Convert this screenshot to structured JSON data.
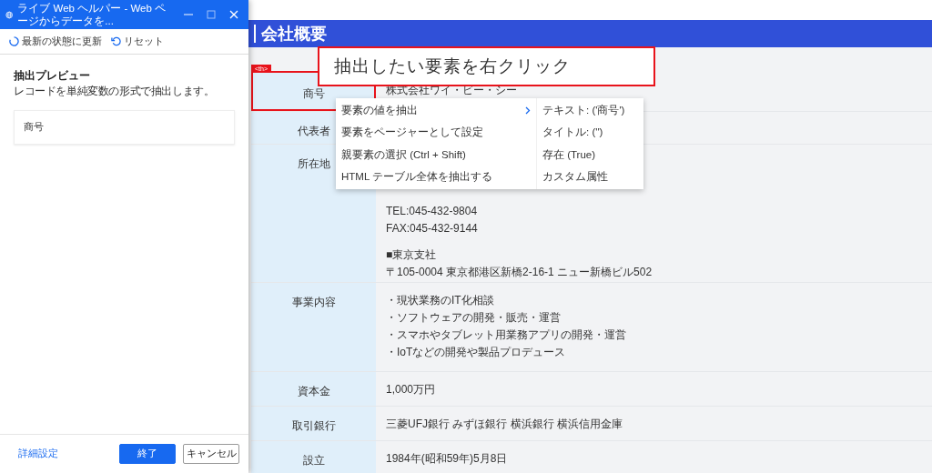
{
  "helper_window": {
    "title": "ライブ Web ヘルパー - Web ページからデータを...",
    "toolbar": [
      {
        "label": "最新の状態に更新",
        "kind": "refresh"
      },
      {
        "label": "リセット",
        "kind": "reset"
      }
    ],
    "preview": {
      "heading": "抽出プレビュー",
      "description": "レコードを単純変数の形式で抽出します。",
      "columns": [
        "商号"
      ]
    },
    "advanced_link": "詳細設定",
    "buttons": [
      {
        "label": "終了",
        "kind": "primary"
      },
      {
        "label": "キャンセル",
        "kind": "secondary"
      }
    ]
  },
  "web_page": {
    "title": "会社概要",
    "rows": [
      {
        "header": "商号",
        "paragraphs": [
          [
            "株式会社ワイ・ビー・シー"
          ]
        ],
        "highlighted": true
      },
      {
        "header": "代表者",
        "paragraphs": [],
        "highlighted": false
      },
      {
        "header": "所在地",
        "paragraphs": [
          [
            "TEL:045-432-9804",
            "FAX:045-432-9144"
          ],
          [
            "■東京支社",
            "〒105-0004 東京都港区新橋2-16-1 ニュー新橋ビル502"
          ]
        ],
        "highlighted": false
      },
      {
        "header": "事業内容",
        "paragraphs": [
          [
            "・現状業務のIT化相談",
            "・ソフトウェアの開発・販売・運営",
            "・スマホやタブレット用業務アプリの開発・運営",
            "・IoTなどの開発や製品プロデュース"
          ]
        ],
        "highlighted": false
      },
      {
        "header": "資本金",
        "paragraphs": [
          [
            "1,000万円"
          ]
        ],
        "highlighted": false
      },
      {
        "header": "取引銀行",
        "paragraphs": [
          [
            "三菱UFJ銀行 みずほ銀行 横浜銀行 横浜信用金庫"
          ]
        ],
        "highlighted": false
      },
      {
        "header": "設立",
        "paragraphs": [
          [
            "1984年(昭和59年)5月8日"
          ]
        ],
        "highlighted": false
      }
    ]
  },
  "element_tag": "<th>",
  "callout": "抽出したい要素を右クリック",
  "context_menu": {
    "items": [
      {
        "label": "要素の値を抽出",
        "expanded": true
      },
      {
        "label": "要素をページャーとして設定",
        "expanded": false
      },
      {
        "label": "親要素の選択 (Ctrl + Shift)",
        "expanded": false
      },
      {
        "label": "HTML テーブル全体を抽出する",
        "expanded": false
      }
    ],
    "submenu": [
      "テキスト: ('商号')",
      "タイトル: ('')",
      "存在 (True)",
      "カスタム属性"
    ]
  }
}
